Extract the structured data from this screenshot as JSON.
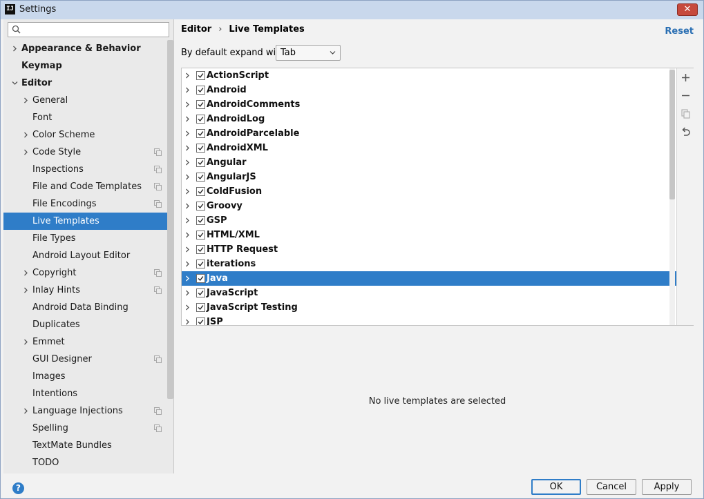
{
  "window": {
    "title": "Settings",
    "app_icon_text": "IJ",
    "close_glyph": "✕"
  },
  "search": {
    "placeholder": "",
    "value": ""
  },
  "tree": [
    {
      "label": "Appearance & Behavior",
      "level": 0,
      "bold": true,
      "arrow": "right",
      "selected": false,
      "project": false
    },
    {
      "label": "Keymap",
      "level": 0,
      "bold": true,
      "arrow": "none",
      "selected": false,
      "project": false
    },
    {
      "label": "Editor",
      "level": 0,
      "bold": true,
      "arrow": "down",
      "selected": false,
      "project": false
    },
    {
      "label": "General",
      "level": 1,
      "bold": false,
      "arrow": "right",
      "selected": false,
      "project": false
    },
    {
      "label": "Font",
      "level": 1,
      "bold": false,
      "arrow": "none",
      "selected": false,
      "project": false
    },
    {
      "label": "Color Scheme",
      "level": 1,
      "bold": false,
      "arrow": "right",
      "selected": false,
      "project": false
    },
    {
      "label": "Code Style",
      "level": 1,
      "bold": false,
      "arrow": "right",
      "selected": false,
      "project": true
    },
    {
      "label": "Inspections",
      "level": 1,
      "bold": false,
      "arrow": "none",
      "selected": false,
      "project": true
    },
    {
      "label": "File and Code Templates",
      "level": 1,
      "bold": false,
      "arrow": "none",
      "selected": false,
      "project": true
    },
    {
      "label": "File Encodings",
      "level": 1,
      "bold": false,
      "arrow": "none",
      "selected": false,
      "project": true
    },
    {
      "label": "Live Templates",
      "level": 1,
      "bold": false,
      "arrow": "none",
      "selected": true,
      "project": false
    },
    {
      "label": "File Types",
      "level": 1,
      "bold": false,
      "arrow": "none",
      "selected": false,
      "project": false
    },
    {
      "label": "Android Layout Editor",
      "level": 1,
      "bold": false,
      "arrow": "none",
      "selected": false,
      "project": false
    },
    {
      "label": "Copyright",
      "level": 1,
      "bold": false,
      "arrow": "right",
      "selected": false,
      "project": true
    },
    {
      "label": "Inlay Hints",
      "level": 1,
      "bold": false,
      "arrow": "right",
      "selected": false,
      "project": true
    },
    {
      "label": "Android Data Binding",
      "level": 1,
      "bold": false,
      "arrow": "none",
      "selected": false,
      "project": false
    },
    {
      "label": "Duplicates",
      "level": 1,
      "bold": false,
      "arrow": "none",
      "selected": false,
      "project": false
    },
    {
      "label": "Emmet",
      "level": 1,
      "bold": false,
      "arrow": "right",
      "selected": false,
      "project": false
    },
    {
      "label": "GUI Designer",
      "level": 1,
      "bold": false,
      "arrow": "none",
      "selected": false,
      "project": true
    },
    {
      "label": "Images",
      "level": 1,
      "bold": false,
      "arrow": "none",
      "selected": false,
      "project": false
    },
    {
      "label": "Intentions",
      "level": 1,
      "bold": false,
      "arrow": "none",
      "selected": false,
      "project": false
    },
    {
      "label": "Language Injections",
      "level": 1,
      "bold": false,
      "arrow": "right",
      "selected": false,
      "project": true
    },
    {
      "label": "Spelling",
      "level": 1,
      "bold": false,
      "arrow": "none",
      "selected": false,
      "project": true
    },
    {
      "label": "TextMate Bundles",
      "level": 1,
      "bold": false,
      "arrow": "none",
      "selected": false,
      "project": false
    },
    {
      "label": "TODO",
      "level": 1,
      "bold": false,
      "arrow": "none",
      "selected": false,
      "project": false
    }
  ],
  "breadcrumb": {
    "parent": "Editor",
    "separator": "›",
    "current": "Live Templates"
  },
  "reset_label": "Reset",
  "expand": {
    "label": "By default expand with",
    "value": "Tab"
  },
  "templates": [
    {
      "name": "ActionScript",
      "checked": true,
      "selected": false
    },
    {
      "name": "Android",
      "checked": true,
      "selected": false
    },
    {
      "name": "AndroidComments",
      "checked": true,
      "selected": false
    },
    {
      "name": "AndroidLog",
      "checked": true,
      "selected": false
    },
    {
      "name": "AndroidParcelable",
      "checked": true,
      "selected": false
    },
    {
      "name": "AndroidXML",
      "checked": true,
      "selected": false
    },
    {
      "name": "Angular",
      "checked": true,
      "selected": false
    },
    {
      "name": "AngularJS",
      "checked": true,
      "selected": false
    },
    {
      "name": "ColdFusion",
      "checked": true,
      "selected": false
    },
    {
      "name": "Groovy",
      "checked": true,
      "selected": false
    },
    {
      "name": "GSP",
      "checked": true,
      "selected": false
    },
    {
      "name": "HTML/XML",
      "checked": true,
      "selected": false
    },
    {
      "name": "HTTP Request",
      "checked": true,
      "selected": false
    },
    {
      "name": "iterations",
      "checked": true,
      "selected": false
    },
    {
      "name": "Java",
      "checked": true,
      "selected": true
    },
    {
      "name": "JavaScript",
      "checked": true,
      "selected": false
    },
    {
      "name": "JavaScript Testing",
      "checked": true,
      "selected": false
    },
    {
      "name": "JSP",
      "checked": true,
      "selected": false
    }
  ],
  "toolbar_icons": [
    "add-icon",
    "remove-icon",
    "copy-icon",
    "restore-icon"
  ],
  "empty_message": "No live templates are selected",
  "buttons": {
    "ok": "OK",
    "cancel": "Cancel",
    "apply": "Apply",
    "help": "?"
  },
  "colors": {
    "selection": "#2f7dc8",
    "link": "#2a6fb3"
  }
}
